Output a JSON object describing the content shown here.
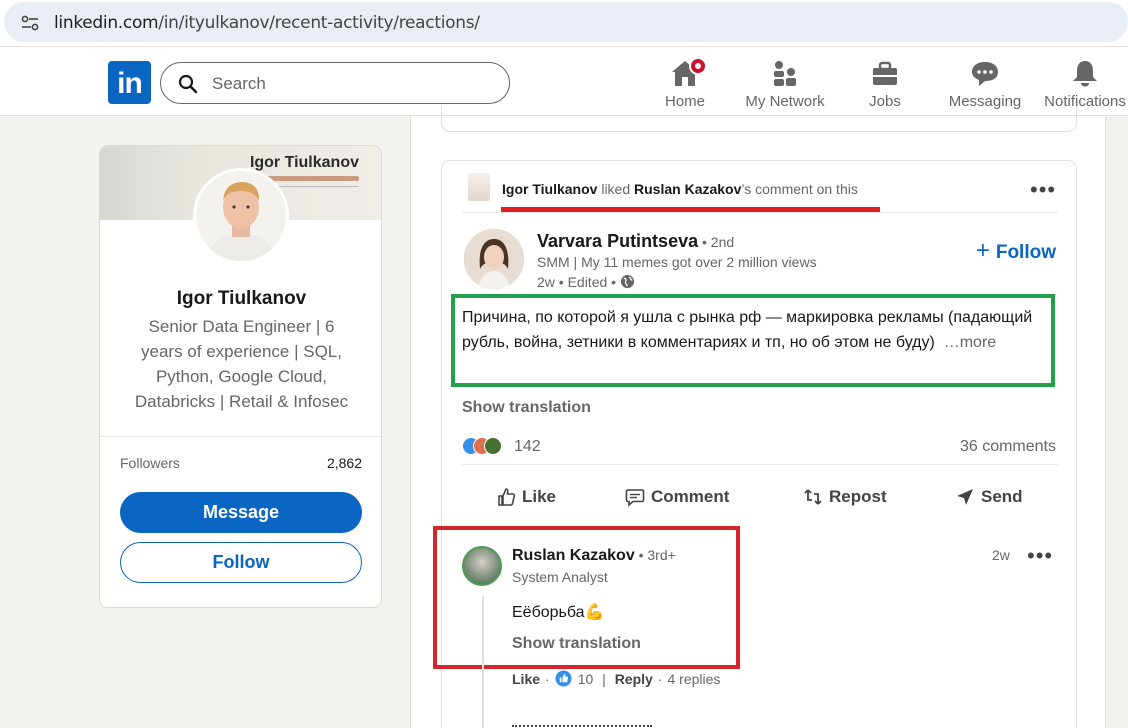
{
  "browser": {
    "url_host": "linkedin.com",
    "url_path": "/in/ityulkanov/recent-activity/reactions/"
  },
  "nav": {
    "logo": "in",
    "search_placeholder": "Search",
    "items": [
      {
        "label": "Home",
        "icon": "home-icon"
      },
      {
        "label": "My Network",
        "icon": "network-icon"
      },
      {
        "label": "Jobs",
        "icon": "briefcase-icon"
      },
      {
        "label": "Messaging",
        "icon": "messaging-icon"
      },
      {
        "label": "Notifications",
        "icon": "bell-icon"
      }
    ]
  },
  "profile": {
    "banner_name": "Igor Tiulkanov",
    "name": "Igor Tiulkanov",
    "headline": "Senior Data Engineer | 6 years of experience | SQL, Python, Google Cloud, Databricks | Retail & Infosec",
    "followers_label": "Followers",
    "followers_value": "2,862",
    "message_label": "Message",
    "follow_label": "Follow"
  },
  "post": {
    "context": {
      "actor": "Igor Tiulkanov",
      "verb": " liked ",
      "target": "Ruslan Kazakov",
      "suffix": "’s comment on this"
    },
    "author": {
      "name": "Varvara Putintseva",
      "degree": " • 2nd",
      "headline": "SMM | My 11 memes got over 2 million views",
      "meta": "2w • Edited • "
    },
    "follow_label": "Follow",
    "body": "Причина, по которой я ушла с рынка рф — маркировка рекламы (падающий рубль, война, зетники в комментариях и тп, но об этом не буду)",
    "more_label": "…more",
    "show_translation": "Show translation",
    "reactions_count": "142",
    "comments_count": "36 comments",
    "actions": [
      "Like",
      "Comment",
      "Repost",
      "Send"
    ]
  },
  "comment": {
    "name": "Ruslan Kazakov",
    "degree": " • 3rd+",
    "headline": "System Analyst",
    "time": "2w",
    "body": "Еёборьба💪",
    "show_translation": "Show translation",
    "like_label": "Like",
    "like_count": "10",
    "reply_label": "Reply",
    "replies": "4 replies"
  },
  "colors": {
    "brand": "#0a66c2",
    "red_annotation": "#d6252d",
    "green_annotation": "#22a14a",
    "badge": "#cb112d"
  }
}
